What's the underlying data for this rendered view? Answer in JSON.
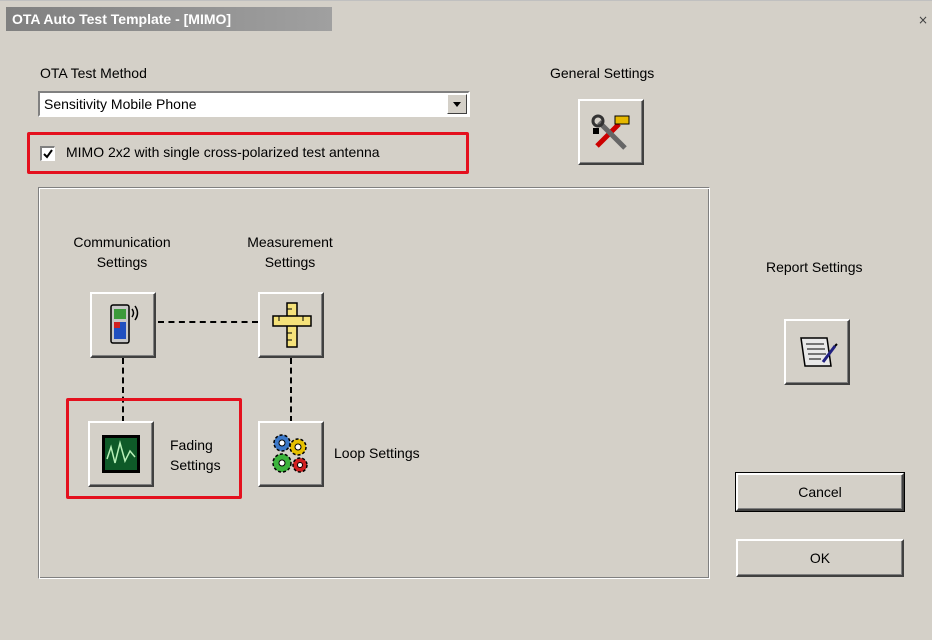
{
  "window": {
    "title": "OTA Auto Test Template - [MIMO]",
    "close_glyph": "×"
  },
  "test_method": {
    "label": "OTA Test Method",
    "selected": "Sensitivity Mobile Phone"
  },
  "mimo_checkbox": {
    "label": "MIMO 2x2 with single cross-polarized test antenna",
    "checked": true
  },
  "general_settings": {
    "label": "General Settings",
    "icon": "tools-icon"
  },
  "communication_settings": {
    "line1": "Communication",
    "line2": "Settings",
    "icon": "mobile-phone-icon"
  },
  "measurement_settings": {
    "line1": "Measurement",
    "line2": "Settings",
    "icon": "ruler-icon"
  },
  "fading_settings": {
    "line1": "Fading",
    "line2": "Settings",
    "icon": "oscilloscope-icon"
  },
  "loop_settings": {
    "label": "Loop Settings",
    "icon": "gears-icon"
  },
  "report_settings": {
    "label": "Report Settings",
    "icon": "report-scroll-icon"
  },
  "buttons": {
    "cancel": "Cancel",
    "ok": "OK"
  },
  "colors": {
    "highlight": "#e4101e",
    "dialog_bg": "#d4d0c8"
  }
}
